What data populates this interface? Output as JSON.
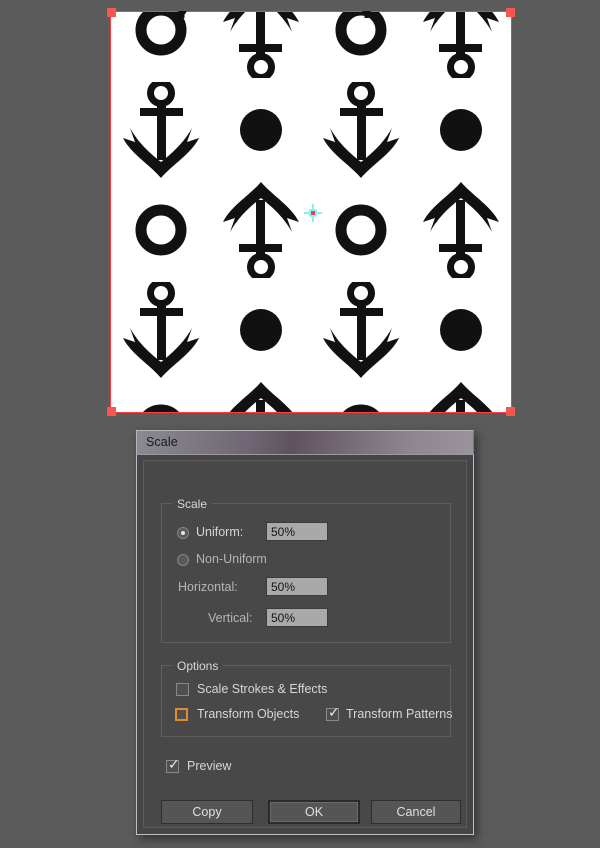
{
  "app": {
    "background_color": "#5b5b5b"
  },
  "canvas": {
    "name": "artboard-pattern-preview",
    "selection_color": "#ff3b3b",
    "handle_color": "#f8564f",
    "artwork_background": "#ffffff",
    "artwork_fill": "#111111",
    "reference_point": {
      "label": "transform-reference-point",
      "cross_color": "#2ee6f0",
      "center_color": "#e8453c"
    },
    "pattern": {
      "description": "anchor-and-circle repeating pattern",
      "columns": 4,
      "rows": 4,
      "tiles": [
        [
          "ring",
          "anchor-down",
          "ring",
          "anchor-down"
        ],
        [
          "anchor-up",
          "dot",
          "anchor-up",
          "dot"
        ],
        [
          "ring",
          "anchor-down",
          "ring",
          "anchor-down"
        ],
        [
          "anchor-up",
          "dot",
          "anchor-up",
          "dot"
        ]
      ]
    }
  },
  "dialog": {
    "title": "Scale",
    "scale_group": {
      "legend": "Scale",
      "uniform": {
        "label": "Uniform:",
        "selected": true,
        "value": "50%",
        "placeholder": "50%"
      },
      "non_uniform": {
        "label": "Non-Uniform",
        "selected": false
      },
      "horizontal": {
        "label": "Horizontal:",
        "value": "50%",
        "placeholder": "50%"
      },
      "vertical": {
        "label": "Vertical:",
        "value": "50%",
        "placeholder": "50%"
      }
    },
    "options_group": {
      "legend": "Options",
      "scale_strokes": {
        "label": "Scale Strokes & Effects",
        "checked": false
      },
      "transform_objects": {
        "label": "Transform Objects",
        "checked": false,
        "focused": true,
        "focus_color": "#e08c2a"
      },
      "transform_patterns": {
        "label": "Transform Patterns",
        "checked": true
      }
    },
    "preview": {
      "label": "Preview",
      "checked": true
    },
    "buttons": {
      "copy": "Copy",
      "ok": "OK",
      "cancel": "Cancel",
      "default": "OK"
    }
  }
}
